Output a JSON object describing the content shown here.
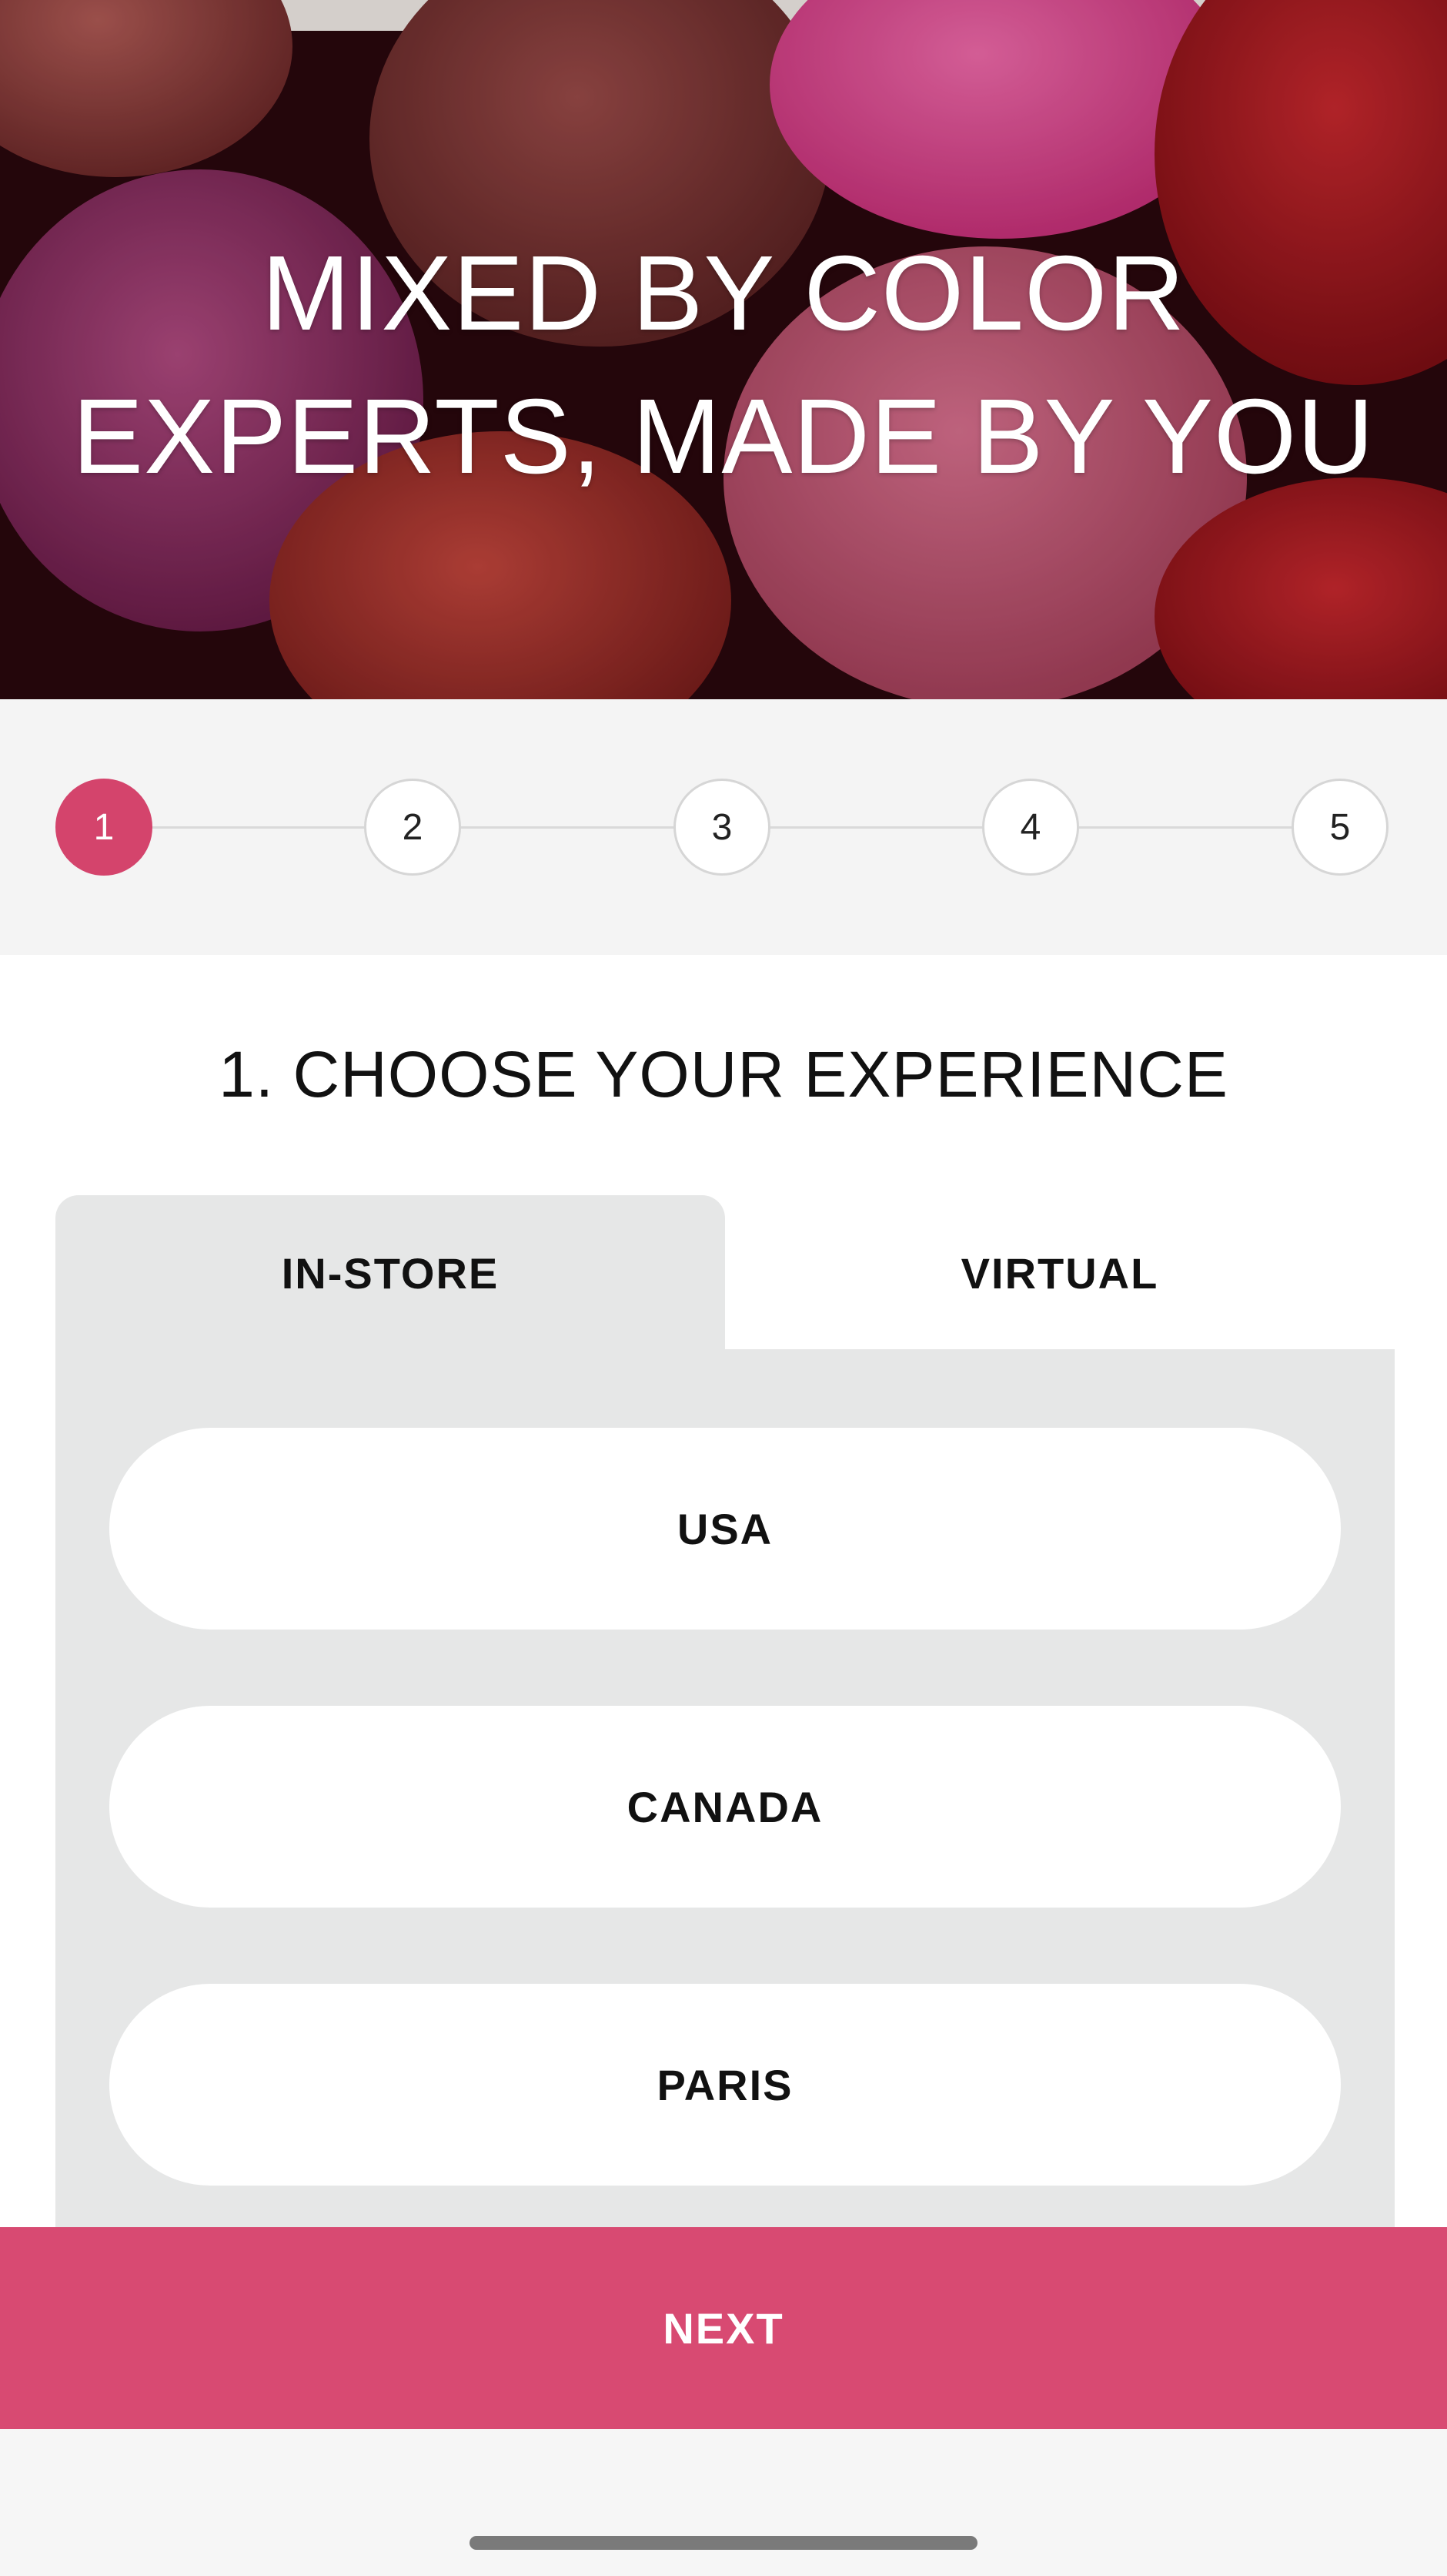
{
  "hero": {
    "title_line1": "MIXED BY COLOR",
    "title_line2": "EXPERTS, MADE BY YOU"
  },
  "stepper": {
    "current_step": 1,
    "steps": [
      "1",
      "2",
      "3",
      "4",
      "5"
    ],
    "active_color": "#d4446c"
  },
  "section": {
    "title": "1. CHOOSE YOUR EXPERIENCE"
  },
  "tabs": {
    "selected": "IN-STORE",
    "items": [
      {
        "label": "IN-STORE"
      },
      {
        "label": "VIRTUAL"
      }
    ]
  },
  "options": [
    {
      "label": "USA"
    },
    {
      "label": "CANADA"
    },
    {
      "label": "PARIS"
    }
  ],
  "footer": {
    "next_label": "NEXT",
    "next_color": "#d84a72"
  }
}
